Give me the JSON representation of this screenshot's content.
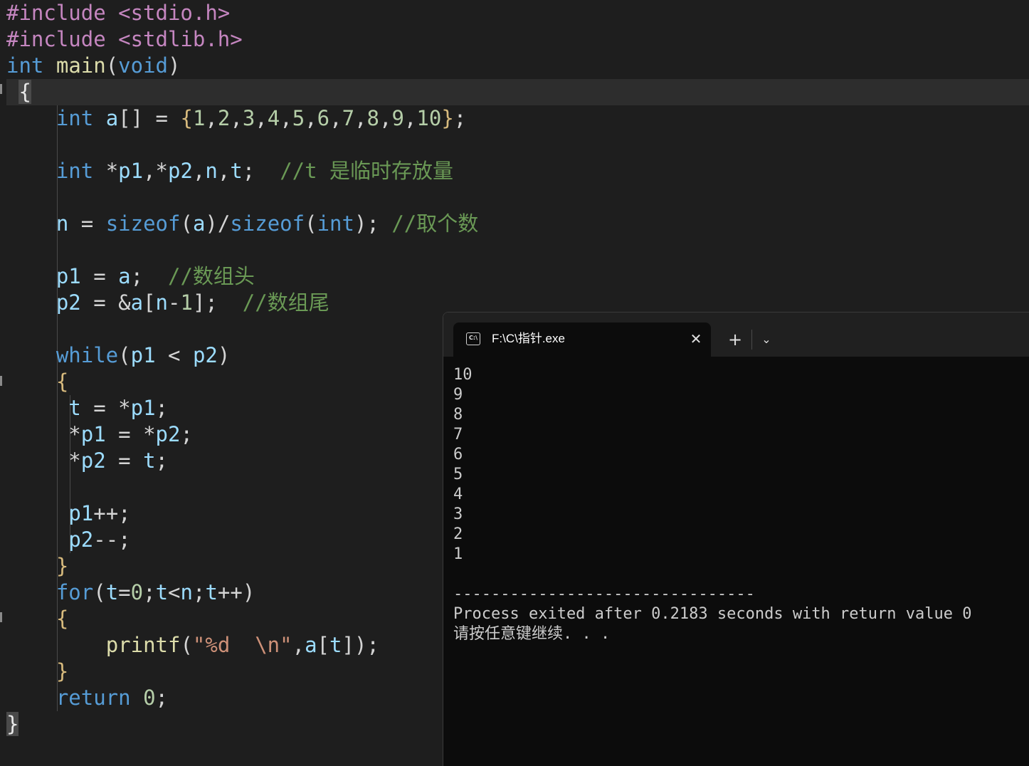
{
  "editor": {
    "lines": [
      [
        {
          "t": "#include <stdio.h>",
          "c": "pp"
        }
      ],
      [
        {
          "t": "#include <stdlib.h>",
          "c": "pp"
        }
      ],
      [
        {
          "t": "int",
          "c": "kw"
        },
        {
          "t": " ",
          "c": "pl"
        },
        {
          "t": "main",
          "c": "fn"
        },
        {
          "t": "(",
          "c": "op"
        },
        {
          "t": "void",
          "c": "kw"
        },
        {
          "t": ")",
          "c": "op"
        }
      ],
      [
        {
          "t": " ",
          "c": "pl"
        },
        {
          "t": "{",
          "c": "brace"
        }
      ],
      [
        {
          "t": "    ",
          "c": "pl"
        },
        {
          "t": "int",
          "c": "kw"
        },
        {
          "t": " ",
          "c": "pl"
        },
        {
          "t": "a",
          "c": "id"
        },
        {
          "t": "[] = ",
          "c": "op"
        },
        {
          "t": "{",
          "c": "br"
        },
        {
          "t": "1",
          "c": "num"
        },
        {
          "t": ",",
          "c": "op"
        },
        {
          "t": "2",
          "c": "num"
        },
        {
          "t": ",",
          "c": "op"
        },
        {
          "t": "3",
          "c": "num"
        },
        {
          "t": ",",
          "c": "op"
        },
        {
          "t": "4",
          "c": "num"
        },
        {
          "t": ",",
          "c": "op"
        },
        {
          "t": "5",
          "c": "num"
        },
        {
          "t": ",",
          "c": "op"
        },
        {
          "t": "6",
          "c": "num"
        },
        {
          "t": ",",
          "c": "op"
        },
        {
          "t": "7",
          "c": "num"
        },
        {
          "t": ",",
          "c": "op"
        },
        {
          "t": "8",
          "c": "num"
        },
        {
          "t": ",",
          "c": "op"
        },
        {
          "t": "9",
          "c": "num"
        },
        {
          "t": ",",
          "c": "op"
        },
        {
          "t": "10",
          "c": "num"
        },
        {
          "t": "}",
          "c": "br"
        },
        {
          "t": ";",
          "c": "op"
        }
      ],
      [
        {
          "t": "    ",
          "c": "pl"
        },
        {
          "t": "int",
          "c": "kw"
        },
        {
          "t": " *",
          "c": "op"
        },
        {
          "t": "p1",
          "c": "id"
        },
        {
          "t": ",*",
          "c": "op"
        },
        {
          "t": "p2",
          "c": "id"
        },
        {
          "t": ",",
          "c": "op"
        },
        {
          "t": "n",
          "c": "id"
        },
        {
          "t": ",",
          "c": "op"
        },
        {
          "t": "t",
          "c": "id"
        },
        {
          "t": ";  ",
          "c": "op"
        },
        {
          "t": "//t 是临时存放量",
          "c": "cm"
        }
      ],
      [
        {
          "t": "    ",
          "c": "pl"
        },
        {
          "t": "n",
          "c": "id"
        },
        {
          "t": " = ",
          "c": "op"
        },
        {
          "t": "sizeof",
          "c": "kw"
        },
        {
          "t": "(",
          "c": "op"
        },
        {
          "t": "a",
          "c": "id"
        },
        {
          "t": ")/",
          "c": "op"
        },
        {
          "t": "sizeof",
          "c": "kw"
        },
        {
          "t": "(",
          "c": "op"
        },
        {
          "t": "int",
          "c": "kw"
        },
        {
          "t": "); ",
          "c": "op"
        },
        {
          "t": "//取个数",
          "c": "cm"
        }
      ],
      [
        {
          "t": "    ",
          "c": "pl"
        },
        {
          "t": "p1",
          "c": "id"
        },
        {
          "t": " = ",
          "c": "op"
        },
        {
          "t": "a",
          "c": "id"
        },
        {
          "t": ";  ",
          "c": "op"
        },
        {
          "t": "//数组头",
          "c": "cm"
        }
      ],
      [
        {
          "t": "    ",
          "c": "pl"
        },
        {
          "t": "p2",
          "c": "id"
        },
        {
          "t": " = &",
          "c": "op"
        },
        {
          "t": "a",
          "c": "id"
        },
        {
          "t": "[",
          "c": "op"
        },
        {
          "t": "n",
          "c": "id"
        },
        {
          "t": "-",
          "c": "op"
        },
        {
          "t": "1",
          "c": "num"
        },
        {
          "t": "];  ",
          "c": "op"
        },
        {
          "t": "//数组尾",
          "c": "cm"
        }
      ],
      [
        {
          "t": "    ",
          "c": "pl"
        },
        {
          "t": "while",
          "c": "kw"
        },
        {
          "t": "(",
          "c": "op"
        },
        {
          "t": "p1",
          "c": "id"
        },
        {
          "t": " < ",
          "c": "op"
        },
        {
          "t": "p2",
          "c": "id"
        },
        {
          "t": ")",
          "c": "op"
        }
      ],
      [
        {
          "t": "    ",
          "c": "pl"
        },
        {
          "t": "{",
          "c": "br"
        }
      ],
      [
        {
          "t": "     ",
          "c": "pl"
        },
        {
          "t": "t",
          "c": "id"
        },
        {
          "t": " = *",
          "c": "op"
        },
        {
          "t": "p1",
          "c": "id"
        },
        {
          "t": ";",
          "c": "op"
        }
      ],
      [
        {
          "t": "     *",
          "c": "op"
        },
        {
          "t": "p1",
          "c": "id"
        },
        {
          "t": " = *",
          "c": "op"
        },
        {
          "t": "p2",
          "c": "id"
        },
        {
          "t": ";",
          "c": "op"
        }
      ],
      [
        {
          "t": "     *",
          "c": "op"
        },
        {
          "t": "p2",
          "c": "id"
        },
        {
          "t": " = ",
          "c": "op"
        },
        {
          "t": "t",
          "c": "id"
        },
        {
          "t": ";",
          "c": "op"
        }
      ],
      [
        {
          "t": "     ",
          "c": "pl"
        },
        {
          "t": "p1",
          "c": "id"
        },
        {
          "t": "++;",
          "c": "op"
        }
      ],
      [
        {
          "t": "     ",
          "c": "pl"
        },
        {
          "t": "p2",
          "c": "id"
        },
        {
          "t": "--;",
          "c": "op"
        }
      ],
      [
        {
          "t": "    ",
          "c": "pl"
        },
        {
          "t": "}",
          "c": "br"
        }
      ],
      [
        {
          "t": "    ",
          "c": "pl"
        },
        {
          "t": "for",
          "c": "kw"
        },
        {
          "t": "(",
          "c": "op"
        },
        {
          "t": "t",
          "c": "id"
        },
        {
          "t": "=",
          "c": "op"
        },
        {
          "t": "0",
          "c": "num"
        },
        {
          "t": ";",
          "c": "op"
        },
        {
          "t": "t",
          "c": "id"
        },
        {
          "t": "<",
          "c": "op"
        },
        {
          "t": "n",
          "c": "id"
        },
        {
          "t": ";",
          "c": "op"
        },
        {
          "t": "t",
          "c": "id"
        },
        {
          "t": "++)",
          "c": "op"
        }
      ],
      [
        {
          "t": "    ",
          "c": "pl"
        },
        {
          "t": "{",
          "c": "br"
        }
      ],
      [
        {
          "t": "        ",
          "c": "pl"
        },
        {
          "t": "printf",
          "c": "fn"
        },
        {
          "t": "(",
          "c": "op"
        },
        {
          "t": "\"%d  \\n\"",
          "c": "str"
        },
        {
          "t": ",",
          "c": "op"
        },
        {
          "t": "a",
          "c": "id"
        },
        {
          "t": "[",
          "c": "op"
        },
        {
          "t": "t",
          "c": "id"
        },
        {
          "t": "]);",
          "c": "op"
        }
      ],
      [
        {
          "t": "    ",
          "c": "pl"
        },
        {
          "t": "}",
          "c": "br"
        }
      ],
      [
        {
          "t": "    ",
          "c": "pl"
        },
        {
          "t": "return",
          "c": "kw"
        },
        {
          "t": " ",
          "c": "pl"
        },
        {
          "t": "0",
          "c": "num"
        },
        {
          "t": ";",
          "c": "op"
        }
      ],
      [
        {
          "t": "}",
          "c": "brace"
        }
      ]
    ]
  },
  "terminal": {
    "tab_title": "F:\\C\\指针.exe",
    "icon_text": "C:\\",
    "close_glyph": "✕",
    "new_tab_glyph": "+",
    "dropdown_glyph": "⌄",
    "output_lines": [
      "10",
      "9",
      "8",
      "7",
      "6",
      "5",
      "4",
      "3",
      "2",
      "1",
      "",
      "--------------------------------",
      "Process exited after 0.2183 seconds with return value 0",
      "请按任意键继续. . ."
    ]
  }
}
